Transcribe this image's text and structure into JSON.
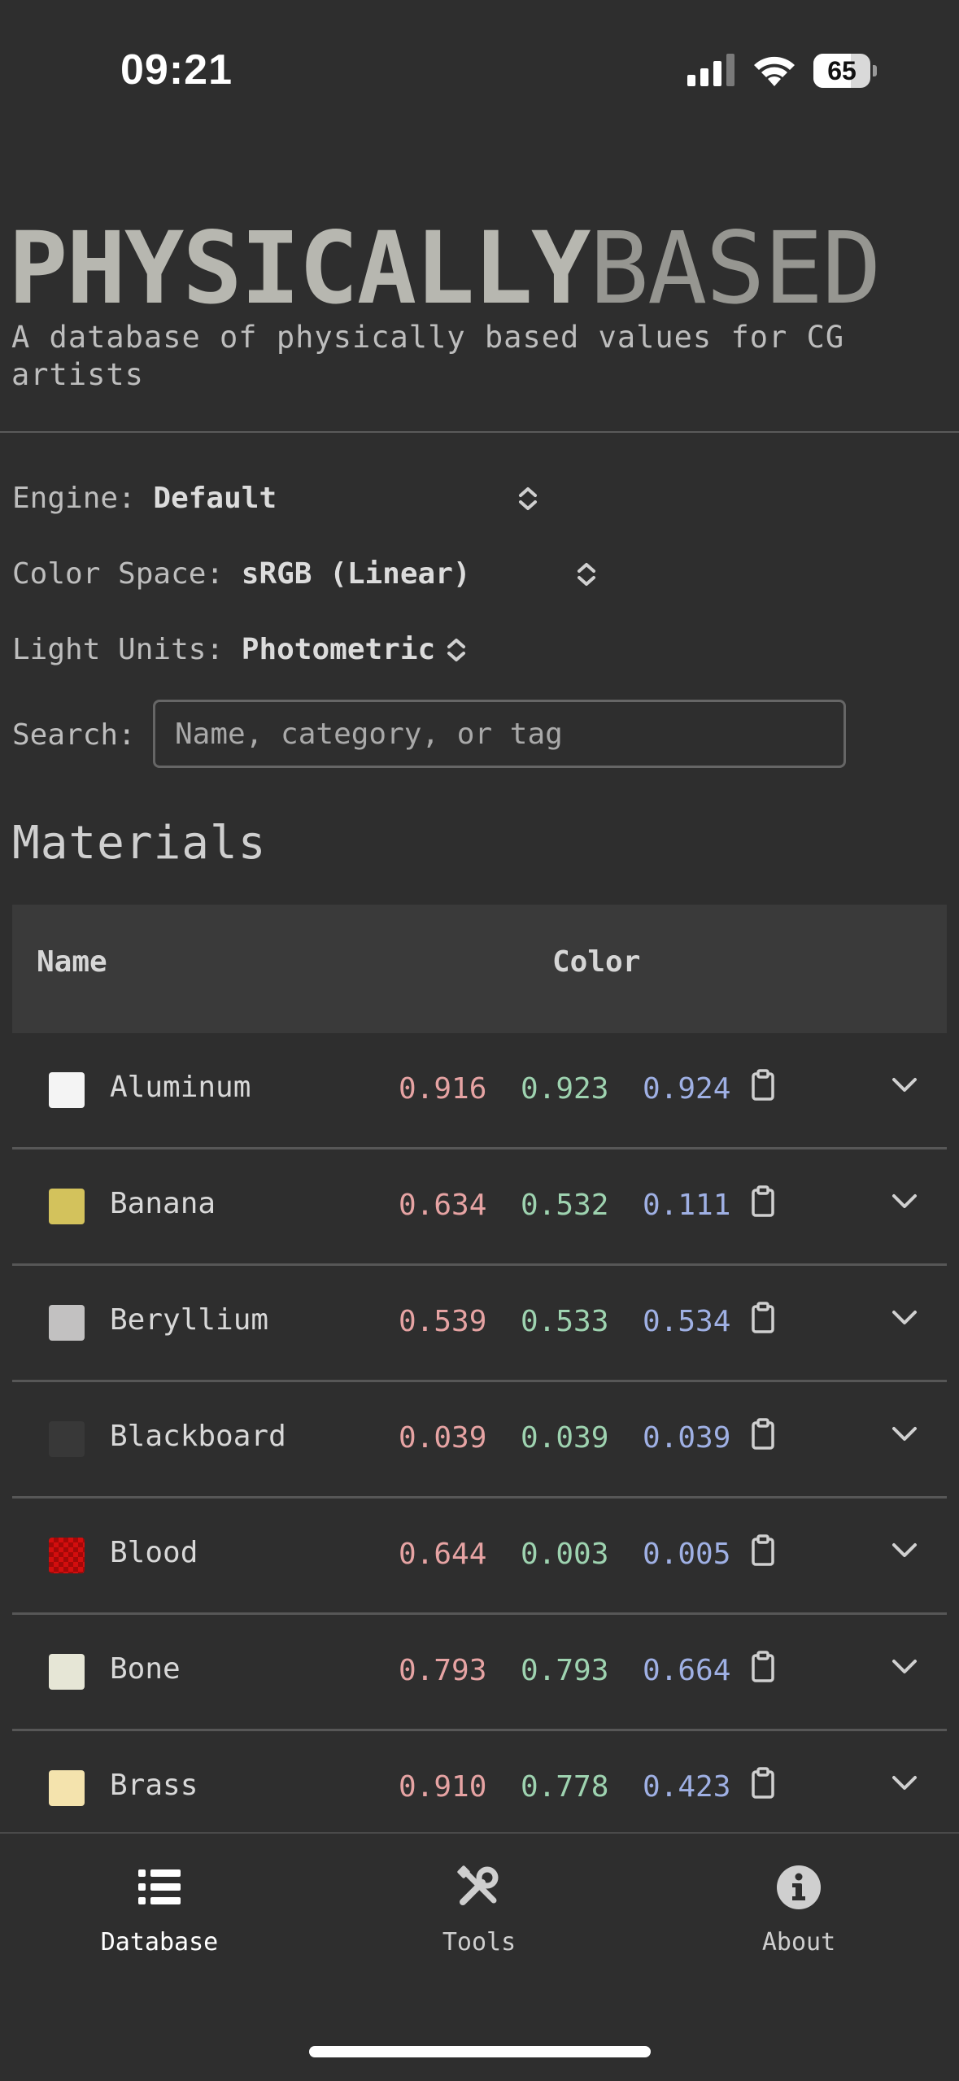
{
  "status_bar": {
    "time": "09:21",
    "battery": "65"
  },
  "header": {
    "title_bold": "PHYSICALLY",
    "title_light": "BASED",
    "subtitle": "A database of physically based values for CG artists"
  },
  "settings": {
    "engine": {
      "label": "Engine:",
      "value": "Default"
    },
    "color_space": {
      "label": "Color Space:",
      "value": "sRGB (Linear)"
    },
    "light_units": {
      "label": "Light Units:",
      "value": "Photometric"
    },
    "search": {
      "label": "Search:",
      "placeholder": "Name, category, or tag"
    }
  },
  "materials": {
    "heading": "Materials",
    "columns": {
      "name": "Name",
      "color": "Color"
    },
    "rows": [
      {
        "name": "Aluminum",
        "r": "0.916",
        "g": "0.923",
        "b": "0.924",
        "swatch": "#f4f4f4"
      },
      {
        "name": "Banana",
        "r": "0.634",
        "g": "0.532",
        "b": "0.111",
        "swatch": "#d3c25c"
      },
      {
        "name": "Beryllium",
        "r": "0.539",
        "g": "0.533",
        "b": "0.534",
        "swatch": "#c2c1c1"
      },
      {
        "name": "Blackboard",
        "r": "0.039",
        "g": "0.039",
        "b": "0.039",
        "swatch": "#383838"
      },
      {
        "name": "Blood",
        "r": "0.644",
        "g": "0.003",
        "b": "0.005",
        "swatch": "#d30d0d"
      },
      {
        "name": "Bone",
        "r": "0.793",
        "g": "0.793",
        "b": "0.664",
        "swatch": "#e6e6d6"
      },
      {
        "name": "Brass",
        "r": "0.910",
        "g": "0.778",
        "b": "0.423",
        "swatch": "#f4e3ad"
      }
    ]
  },
  "tabs": [
    {
      "label": "Database",
      "icon": "list-icon",
      "active": true
    },
    {
      "label": "Tools",
      "icon": "tools-icon",
      "active": false
    },
    {
      "label": "About",
      "icon": "info-icon",
      "active": false
    }
  ]
}
